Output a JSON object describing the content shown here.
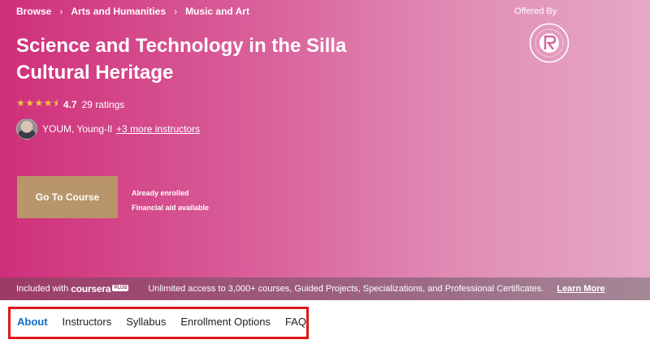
{
  "breadcrumb": [
    "Browse",
    "Arts and Humanities",
    "Music and Art"
  ],
  "course": {
    "title": "Science and Technology in the Silla Cultural Heritage",
    "rating_value": "4.7",
    "rating_count": "29 ratings",
    "stars": "★★★★⯨"
  },
  "instructor": {
    "name": "YOUM, Young-Il",
    "more": "+3 more instructors"
  },
  "cta": {
    "button": "Go To Course",
    "status": "Already enrolled",
    "aid": "Financial aid available"
  },
  "offered_by": "Offered By",
  "plus_bar": {
    "included": "Included with",
    "brand": "coursera",
    "badge": "PLUS",
    "text": "Unlimited access to 3,000+ courses, Guided Projects, Specializations, and Professional Certificates.",
    "learn_more": "Learn More"
  },
  "tabs": [
    "About",
    "Instructors",
    "Syllabus",
    "Enrollment Options",
    "FAQ"
  ],
  "colors": {
    "hero_start": "#cf2f79",
    "button": "#b8956a",
    "active_tab": "#0f6fc6",
    "highlight_box": "#e01818"
  }
}
